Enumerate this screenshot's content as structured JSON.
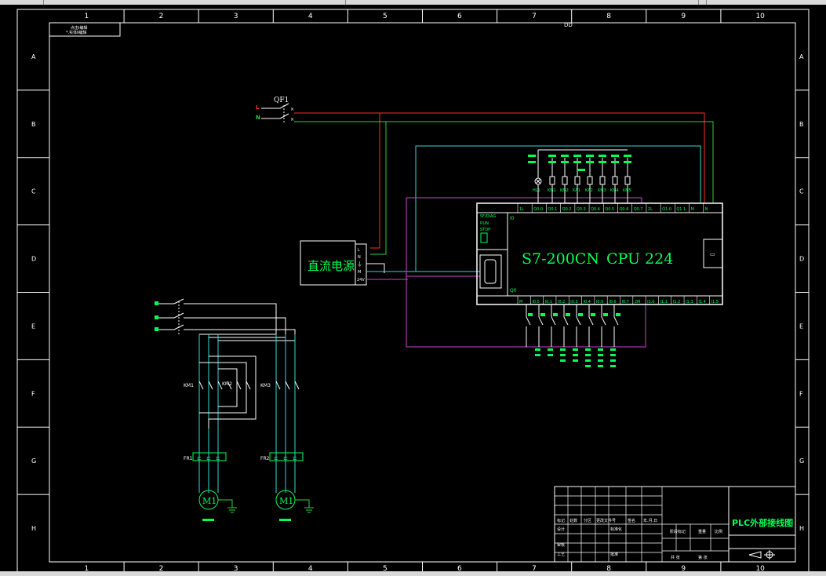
{
  "grid": {
    "columns": [
      "1",
      "2",
      "3",
      "4",
      "5",
      "6",
      "7",
      "8",
      "9",
      "10"
    ],
    "rows": [
      "A",
      "B",
      "C",
      "D",
      "E",
      "F",
      "G",
      "H"
    ]
  },
  "frame_marks": {
    "top_center": "DD"
  },
  "corner_label": {
    "line1": "点击Ⅰ编辑",
    "line2": "*.实体Ⅱ编辑"
  },
  "breaker": {
    "label": "QF1",
    "phase_l": "L",
    "phase_n": "N"
  },
  "power_supply": {
    "title": "直流电源",
    "terminals": [
      "L",
      "N",
      "⏚",
      "M",
      "24V"
    ]
  },
  "plc": {
    "model": "S7-200CN",
    "cpu": "CPU 224",
    "top_terminals": [
      "1L",
      "Q0.0",
      "Q0.1",
      "Q0.2",
      "Q0.3",
      "Q0.4",
      "Q0.5",
      "Q0.6",
      "Q0.7",
      "2L",
      "Q1.0",
      "Q1.1",
      "M",
      "N"
    ],
    "bottom_terminals": [
      "M",
      "I0.0",
      "I0.1",
      "I0.2",
      "I0.3",
      "I0.4",
      "I0.5",
      "I0.6",
      "I0.7",
      "2M",
      "I1.0",
      "I1.1",
      "I1.2",
      "I1.3",
      "I1.4",
      "I1.5"
    ],
    "status": [
      "SF/DIAG",
      "RUN",
      "STOP"
    ],
    "side_top": "I0",
    "side_bottom": "Q0"
  },
  "outputs": {
    "codes": [
      "KM1",
      "KM2",
      "KA1",
      "KA2",
      "KM3",
      "KM4",
      "KM5"
    ],
    "lamp": "HL1"
  },
  "motors": [
    {
      "label": "M1",
      "contactor": "KM1",
      "overload": "FR1"
    },
    {
      "label": "M1",
      "contactor": "KM3",
      "overload": "FR2"
    }
  ],
  "title_block": {
    "drawing_title": "PLC外部接线图",
    "cells": [
      "标记",
      "处数",
      "分区",
      "更改文件号",
      "签名",
      "年.月.日",
      "设计",
      "标准化",
      "阶段标记",
      "重量",
      "比例",
      "审核",
      "工艺",
      "批准",
      "共 张",
      "第 张"
    ]
  },
  "colors": {
    "frame": "#ffffff",
    "accent": "#00ff55",
    "live": "#ff2a2a",
    "neutral": "#31d13a",
    "signal": "#33d6d6",
    "bus": "#d23fd2"
  }
}
